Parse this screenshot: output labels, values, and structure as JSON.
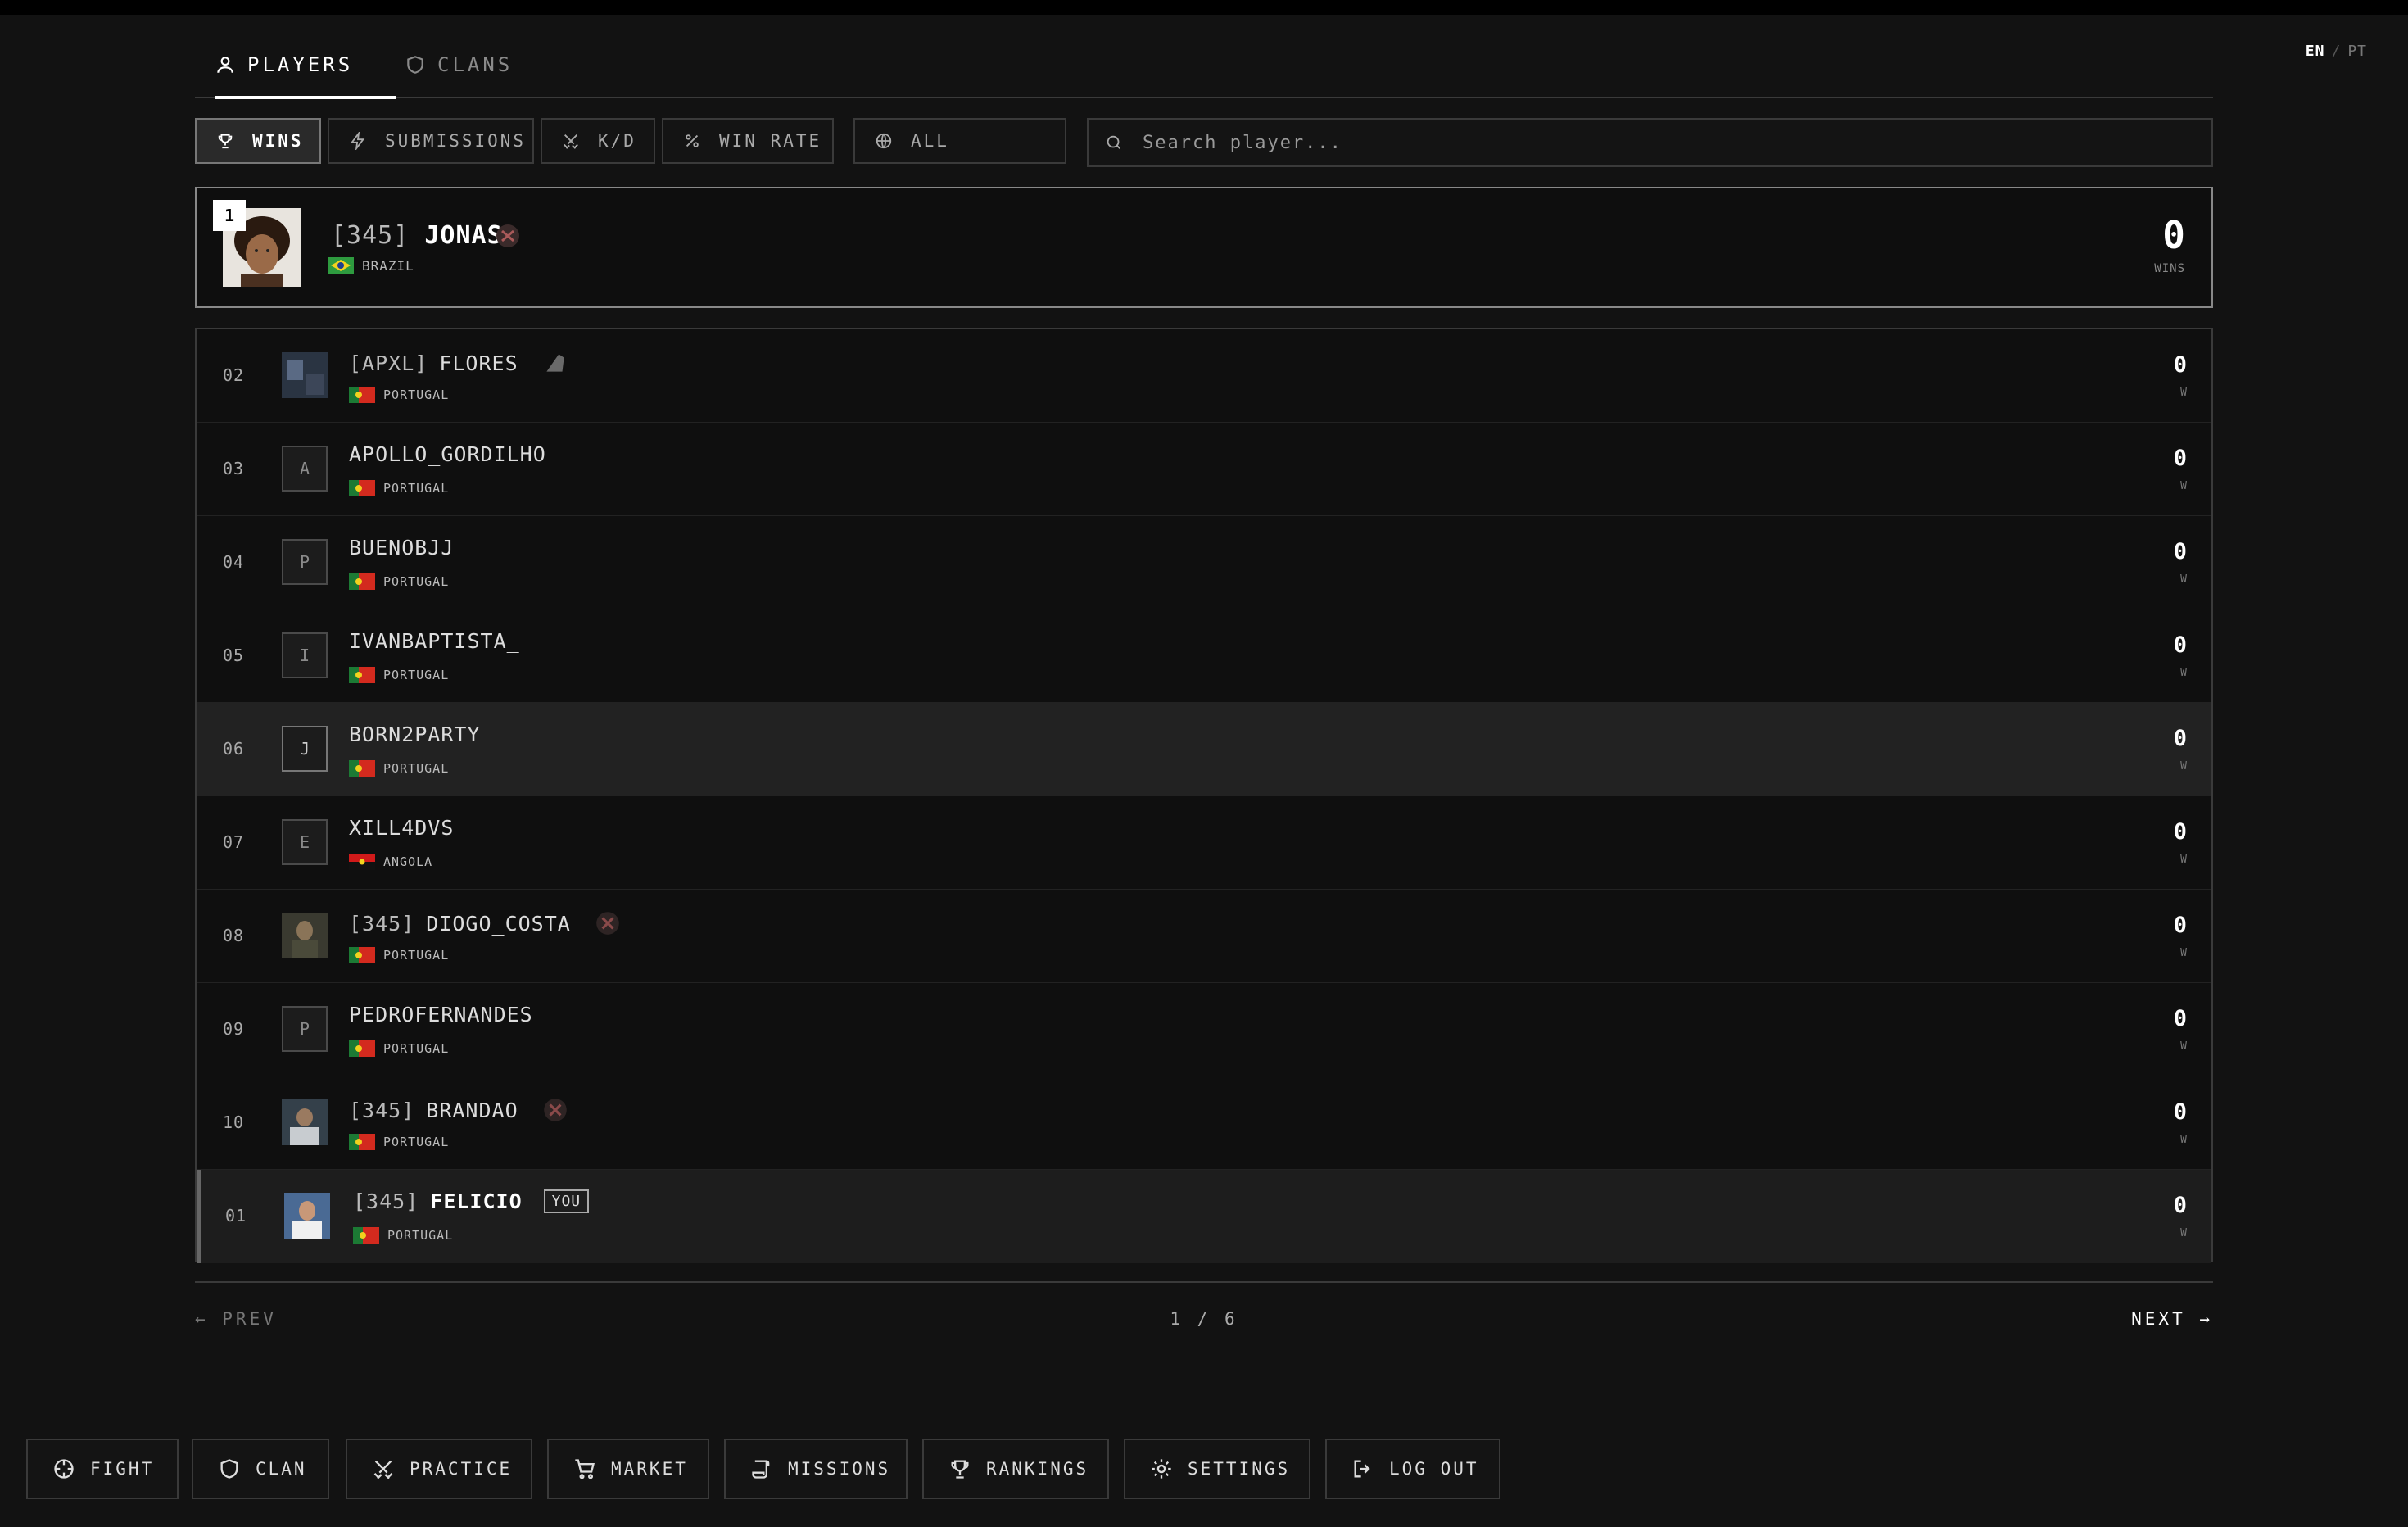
{
  "lang": {
    "active": "EN",
    "sep": "/",
    "other": "PT"
  },
  "tabs": [
    {
      "label": "PLAYERS"
    },
    {
      "label": "CLANS"
    }
  ],
  "filters": [
    {
      "label": "WINS"
    },
    {
      "label": "SUBMISSIONS"
    },
    {
      "label": "K/D"
    },
    {
      "label": "WIN RATE"
    },
    {
      "label": "ALL"
    }
  ],
  "search": {
    "placeholder": "Search player..."
  },
  "top_player": {
    "rank": "1",
    "tag": "[345]",
    "name": "JONAS",
    "country": "BRAZIL",
    "value": "0",
    "unit": "WINS"
  },
  "players": [
    {
      "rank": "02",
      "tag": "[APXL]",
      "name": "FLORES",
      "country": "PORTUGAL",
      "avatar": "",
      "value": "0",
      "unit": "W"
    },
    {
      "rank": "03",
      "tag": "",
      "name": "APOLLO_GORDILHO",
      "country": "PORTUGAL",
      "avatar": "A",
      "value": "0",
      "unit": "W"
    },
    {
      "rank": "04",
      "tag": "",
      "name": "BUENOBJJ",
      "country": "PORTUGAL",
      "avatar": "P",
      "value": "0",
      "unit": "W"
    },
    {
      "rank": "05",
      "tag": "",
      "name": "IVANBAPTISTA_",
      "country": "PORTUGAL",
      "avatar": "I",
      "value": "0",
      "unit": "W"
    },
    {
      "rank": "06",
      "tag": "",
      "name": "BORN2PARTY",
      "country": "PORTUGAL",
      "avatar": "J",
      "value": "0",
      "unit": "W"
    },
    {
      "rank": "07",
      "tag": "",
      "name": "XILL4DVS",
      "country": "ANGOLA",
      "avatar": "E",
      "value": "0",
      "unit": "W"
    },
    {
      "rank": "08",
      "tag": "[345]",
      "name": "DIOGO_COSTA",
      "country": "PORTUGAL",
      "avatar": "",
      "value": "0",
      "unit": "W"
    },
    {
      "rank": "09",
      "tag": "",
      "name": "PEDROFERNANDES",
      "country": "PORTUGAL",
      "avatar": "P",
      "value": "0",
      "unit": "W"
    },
    {
      "rank": "10",
      "tag": "[345]",
      "name": "BRANDAO",
      "country": "PORTUGAL",
      "avatar": "",
      "value": "0",
      "unit": "W"
    },
    {
      "rank": "01",
      "tag": "[345]",
      "name": "FELICIO",
      "country": "PORTUGAL",
      "avatar": "",
      "value": "0",
      "unit": "W",
      "badge": "YOU"
    }
  ],
  "pager": {
    "prev": "← PREV",
    "page": "1 / 6",
    "next": "NEXT →"
  },
  "nav": [
    {
      "label": "FIGHT",
      "icon": "crosshair-icon"
    },
    {
      "label": "CLAN",
      "icon": "shield-icon"
    },
    {
      "label": "PRACTICE",
      "icon": "swords-icon"
    },
    {
      "label": "MARKET",
      "icon": "cart-icon"
    },
    {
      "label": "MISSIONS",
      "icon": "scroll-icon"
    },
    {
      "label": "RANKINGS",
      "icon": "trophy-icon"
    },
    {
      "label": "SETTINGS",
      "icon": "gear-icon"
    },
    {
      "label": "LOG OUT",
      "icon": "logout-icon"
    }
  ]
}
